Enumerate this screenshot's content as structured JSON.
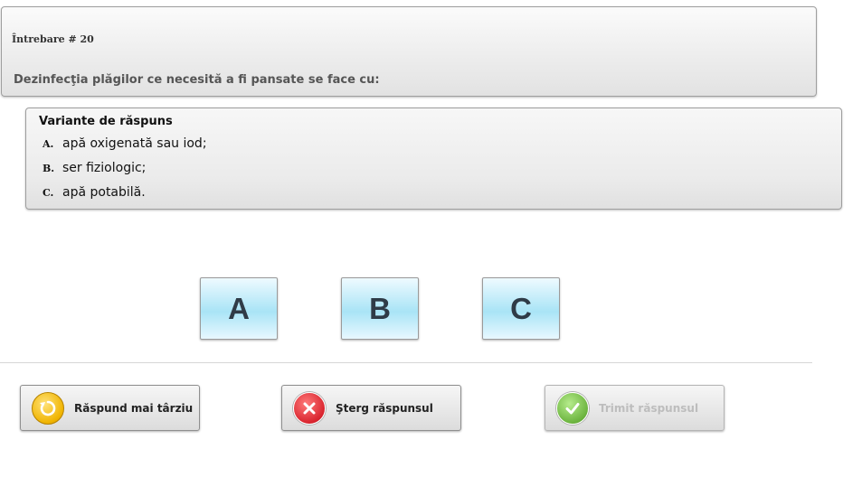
{
  "question": {
    "number_label": "Întrebare  # 20",
    "text": "Dezinfecţia plăgilor ce necesită a fi pansate se face cu:"
  },
  "answers": {
    "title": "Variante de răspuns",
    "options": [
      {
        "letter": "A.",
        "text": "apă oxigenată sau iod;"
      },
      {
        "letter": "B.",
        "text": "ser fiziologic;"
      },
      {
        "letter": "C.",
        "text": "apă potabilă."
      }
    ]
  },
  "choices": [
    "A",
    "B",
    "C"
  ],
  "actions": {
    "later": {
      "label": "Răspund mai târziu",
      "icon": "refresh-icon",
      "color": "#f0b400"
    },
    "clear": {
      "label": "Şterg răspunsul",
      "icon": "close-icon",
      "color": "#d9252f"
    },
    "submit": {
      "label": "Trimit răspunsul",
      "icon": "checkmark-icon",
      "color": "#6cb43f",
      "enabled": false
    }
  }
}
